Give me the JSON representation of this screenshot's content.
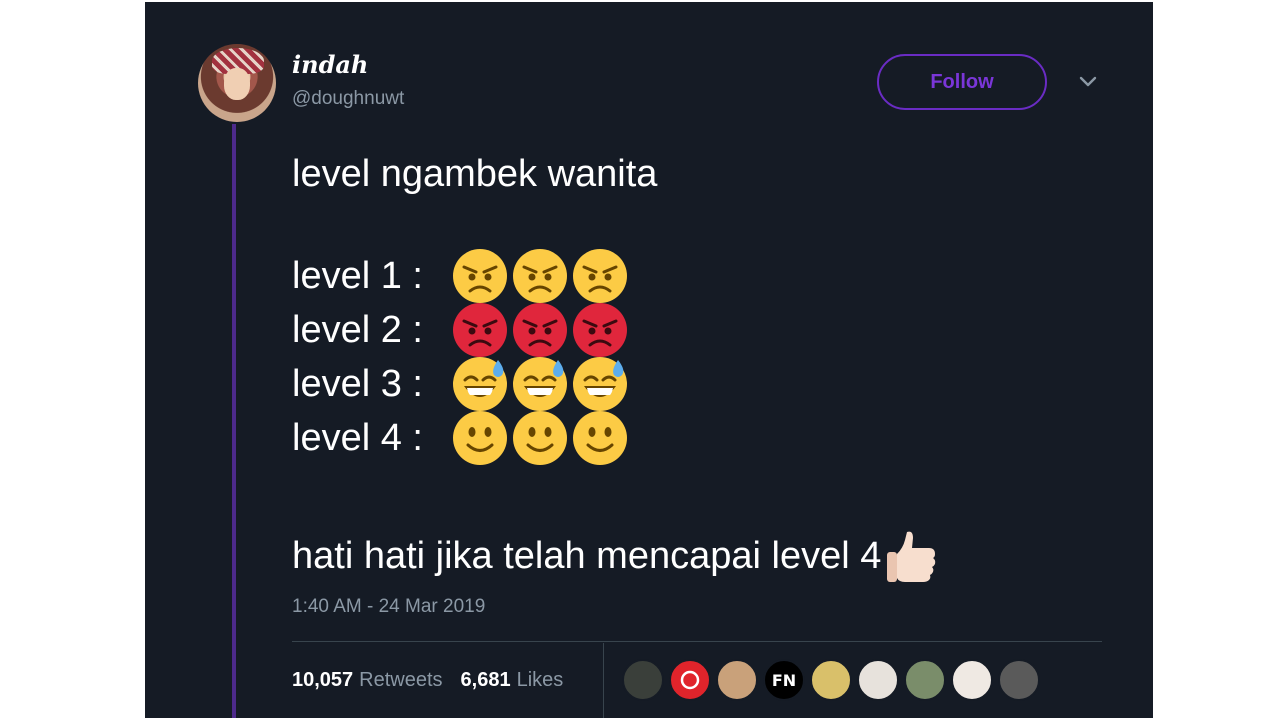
{
  "author": {
    "display_name": "indah",
    "handle": "@doughnuwt",
    "avatar_icon": "profile-photo"
  },
  "follow_button": {
    "label": "Follow",
    "color": "#7a36d8"
  },
  "tweet": {
    "title": "level ngambek wanita",
    "levels": [
      {
        "label": "level 1 :",
        "emoji": "angry-face-icon"
      },
      {
        "label": "level 2 :",
        "emoji": "pouting-face-icon"
      },
      {
        "label": "level 3 :",
        "emoji": "grinning-sweat-face-icon"
      },
      {
        "label": "level 4 :",
        "emoji": "slightly-smiling-face-icon"
      }
    ],
    "final_line": "hati hati jika telah mencapai level 4",
    "final_emoji": "thumbs-up-icon",
    "timestamp": "1:40 AM - 24 Mar 2019"
  },
  "stats": {
    "retweets_count": "10,057",
    "retweets_label": "Retweets",
    "likes_count": "6,681",
    "likes_label": "Likes"
  },
  "likers": [
    {
      "icon": "liker-avatar-1",
      "color": "#3a3f3a"
    },
    {
      "icon": "liker-avatar-2",
      "color": "#e0242b"
    },
    {
      "icon": "liker-avatar-3",
      "color": "#c9a17a"
    },
    {
      "icon": "liker-avatar-4",
      "color": "#000000",
      "text": "FN"
    },
    {
      "icon": "liker-avatar-5",
      "color": "#d9c06a"
    },
    {
      "icon": "liker-avatar-6",
      "color": "#e7e2dc"
    },
    {
      "icon": "liker-avatar-7",
      "color": "#7a8d6a"
    },
    {
      "icon": "liker-avatar-8",
      "color": "#efe9e3"
    },
    {
      "icon": "liker-avatar-9",
      "color": "#5a5a5a"
    }
  ],
  "colors": {
    "background": "#151b25",
    "thread_line": "#4d2a8c",
    "text": "#ffffff",
    "muted": "#8b98a5"
  }
}
